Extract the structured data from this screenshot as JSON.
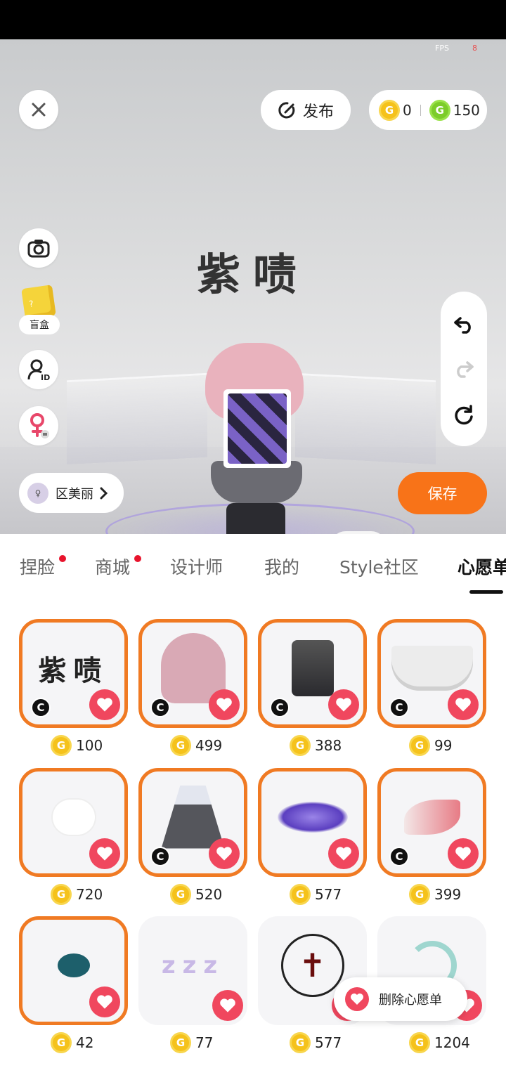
{
  "status": {
    "fps_label": "FPS",
    "fps_value": "8"
  },
  "top": {
    "publish_label": "发布",
    "gold_coin_count": "0",
    "green_coin_count": "150",
    "coin_letter": "G"
  },
  "left_tools": {
    "blind_box_label": "盲盒",
    "id_badge": "ID"
  },
  "stage": {
    "name_text": "紫啧"
  },
  "user": {
    "name": "区美丽"
  },
  "save_label": "保存",
  "tabs": [
    {
      "label": "捏脸",
      "has_dot": true
    },
    {
      "label": "商城",
      "has_dot": true
    },
    {
      "label": "设计师",
      "has_dot": false
    },
    {
      "label": "我的",
      "has_dot": false
    },
    {
      "label": "Style社区",
      "has_dot": false
    },
    {
      "label": "心愿单",
      "has_dot": false,
      "active": true
    }
  ],
  "grid": [
    {
      "art": "紫啧",
      "price": "100",
      "creator_badge": "C",
      "selected": true
    },
    {
      "art": "pink-hair",
      "price": "499",
      "creator_badge": "C",
      "selected": true
    },
    {
      "art": "boots",
      "price": "388",
      "creator_badge": "C",
      "selected": true
    },
    {
      "art": "shorts",
      "price": "99",
      "creator_badge": "C",
      "selected": true
    },
    {
      "art": "rabbit",
      "price": "720",
      "creator_badge": "",
      "selected": true
    },
    {
      "art": "dress",
      "price": "520",
      "creator_badge": "C",
      "selected": true
    },
    {
      "art": "magic-circle",
      "price": "577",
      "creator_badge": "",
      "selected": true
    },
    {
      "art": "feather",
      "price": "399",
      "creator_badge": "C",
      "selected": true
    },
    {
      "art": "pacifier",
      "price": "42",
      "creator_badge": "",
      "selected": true
    },
    {
      "art": "zzz",
      "price": "77",
      "creator_badge": "",
      "selected": false
    },
    {
      "art": "cross-circle",
      "price": "577",
      "creator_badge": "",
      "selected": false
    },
    {
      "art": "snake",
      "price": "1204",
      "creator_badge": "",
      "selected": false
    }
  ],
  "toast": {
    "label": "删除心愿单"
  },
  "colors": {
    "accent": "#f87318",
    "heart": "#f0475e",
    "coin_gold": "#f5c21b",
    "coin_green": "#7ccc2a"
  }
}
